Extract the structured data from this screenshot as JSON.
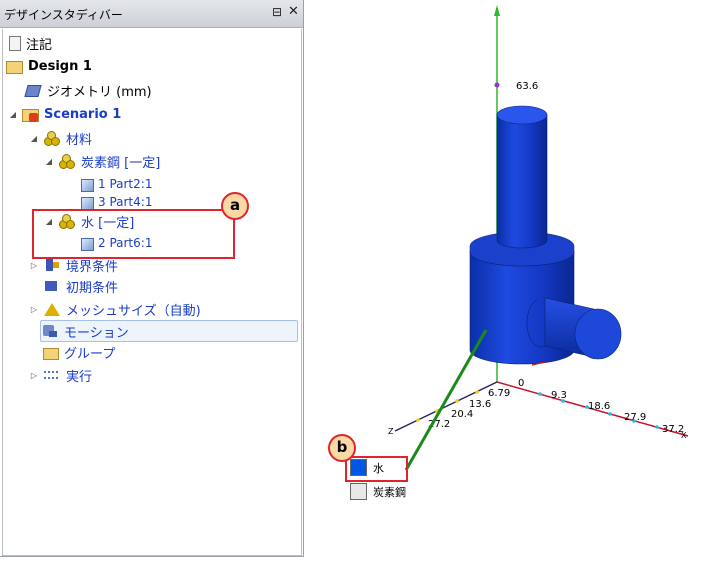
{
  "panel": {
    "title": "デザインスタディバー",
    "pin_icon": "pin-icon",
    "close_label": "✕"
  },
  "tree": {
    "note": "注記",
    "design": "Design 1",
    "geometry": "ジオメトリ (mm)",
    "scenario": "Scenario 1",
    "materials": "材料",
    "carbon_steel": "炭素鋼 [一定]",
    "part2": "1 Part2:1",
    "part4": "3 Part4:1",
    "water": "水 [一定]",
    "part6": "2 Part6:1",
    "boundary": "境界条件",
    "initial": "初期条件",
    "mesh": "メッシュサイズ（自動)",
    "motion": "モーション",
    "group": "グループ",
    "run": "実行"
  },
  "callouts": {
    "a": "a",
    "b": "b"
  },
  "viewport": {
    "y_tick": "63.6",
    "x_ticks": [
      "0",
      "9.3",
      "18.6",
      "27.9",
      "37.2"
    ],
    "x_axis_label": "X",
    "z_ticks": [
      "6.79",
      "13.6",
      "20.4",
      "27.2"
    ],
    "z_axis_label": "Z",
    "legend": [
      {
        "name": "水",
        "color": "#0057e6"
      },
      {
        "name": "炭素鋼",
        "color": "#e8e8e8"
      }
    ]
  },
  "colors": {
    "part_blue": "#1f48d8",
    "callout_red": "#e0242e",
    "axis_y": "#2db82d",
    "axis_x": "#c8102e",
    "leader_green": "#1a8a1a"
  }
}
